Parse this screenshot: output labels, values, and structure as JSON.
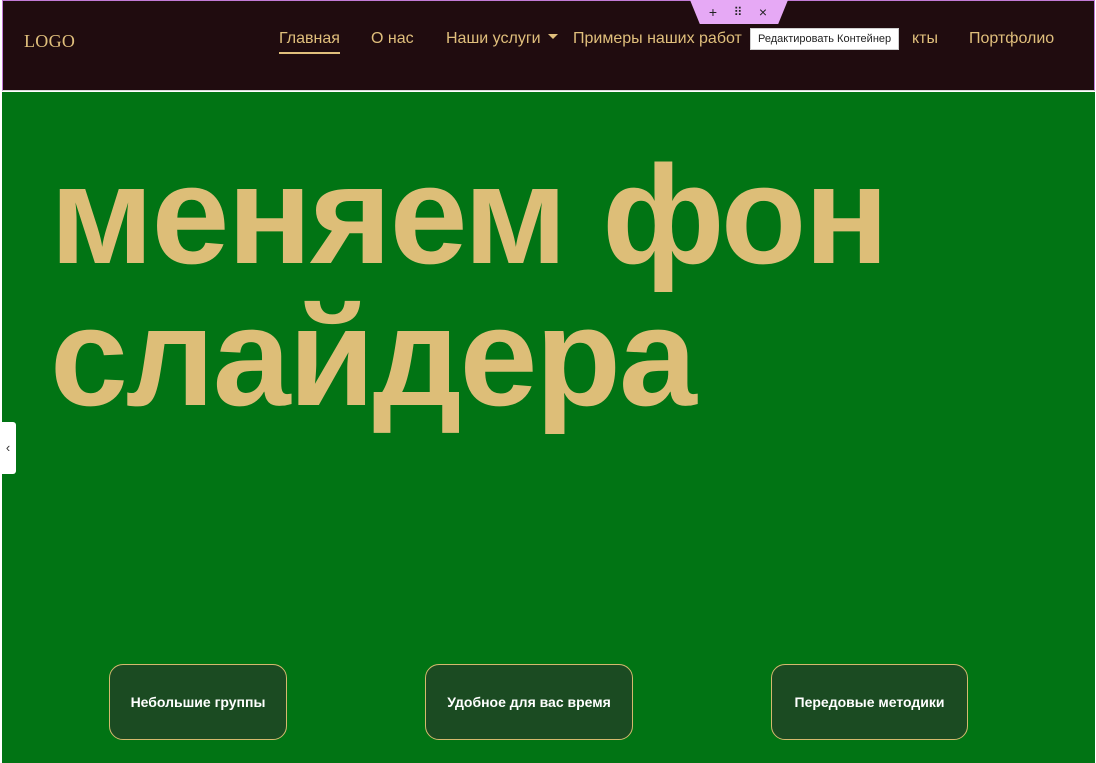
{
  "header": {
    "logo": "LOGO",
    "nav": {
      "home": "Главная",
      "about": "О нас",
      "services": "Наши услуги",
      "works": "Примеры наших работ",
      "contacts": "кты",
      "portfolio": "Портфолио"
    }
  },
  "editor": {
    "add": "+",
    "drag": "⠿",
    "close": "×",
    "tooltip": "Редактировать Контейнер"
  },
  "hero": {
    "title": "меняем фон слайдера",
    "prev_arrow": "‹"
  },
  "features": [
    "Небольшие группы",
    "Удобное для вас время",
    "Передовые методики"
  ],
  "colors": {
    "header_bg": "#200c0f",
    "accent_gold": "#ddbe78",
    "hero_bg": "#017414",
    "feature_bg": "#1b4b22",
    "editor_handle": "#e6a9f5"
  }
}
